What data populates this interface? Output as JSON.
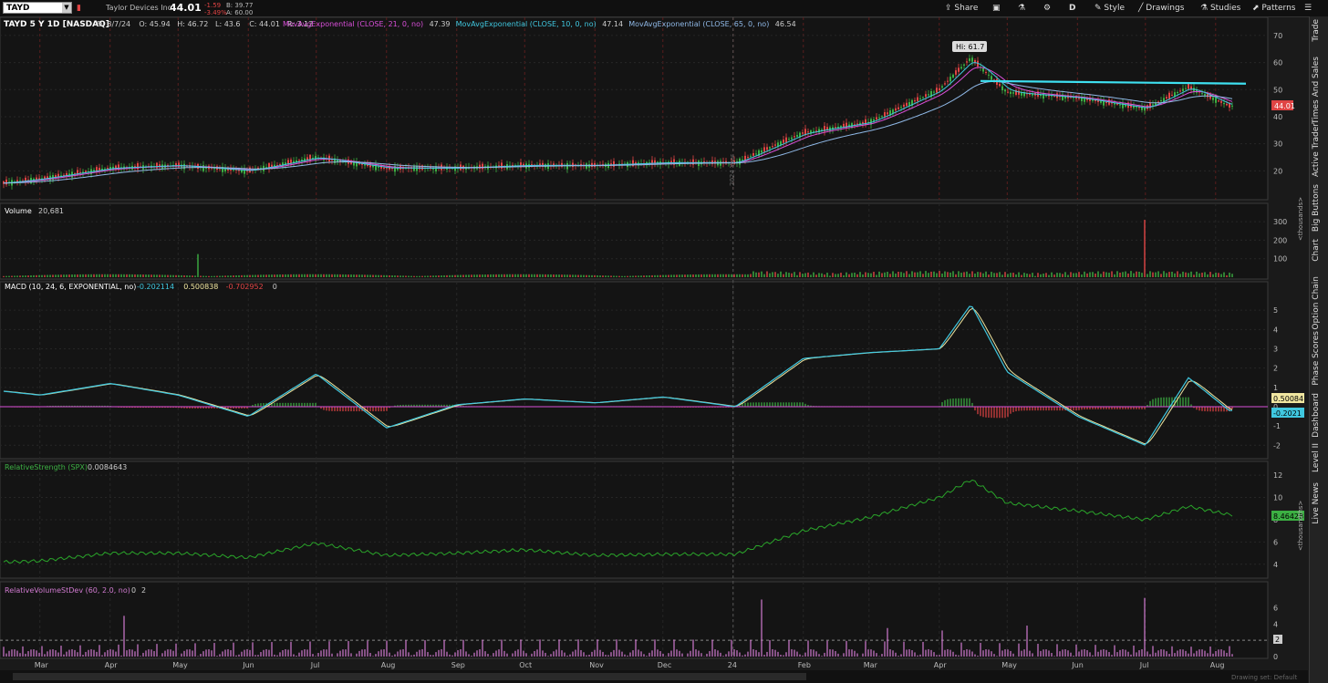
{
  "topbar": {
    "symbol": "TAYD",
    "company": "Taylor Devices Inc",
    "last": "44.01",
    "change": "-1.59",
    "change_pct": "-3.49%",
    "bid": "B: 39.77",
    "ask": "A: 60.00",
    "tools": [
      "Share",
      "D",
      "Style",
      "Drawings",
      "Studies",
      "Patterns"
    ]
  },
  "sidebar_tabs": [
    "Trade",
    "Times And Sales",
    "Active Trader",
    "Big Buttons",
    "Chart",
    "Option Chain",
    "Phase Scores",
    "Dashboard",
    "Level II",
    "Live News"
  ],
  "price_panel": {
    "title": "TAYD 5 Y 1D [NASDAQ]",
    "ohlc": [
      "D: 8/7/24",
      "O: 45.94",
      "H: 46.72",
      "L: 43.6",
      "C: 44.01",
      "R: 3.12"
    ],
    "studies": [
      {
        "label": "MovAvgExponential (CLOSE, 21, 0, no)",
        "value": "47.39",
        "color": "#d94fd9"
      },
      {
        "label": "MovAvgExponential (CLOSE, 10, 0, no)",
        "value": "47.14",
        "color": "#40c8e0"
      },
      {
        "label": "MovAvgExponential (CLOSE, 65, 0, no)",
        "value": "46.54",
        "color": "#8fb8e6"
      }
    ],
    "hi_label": "Hi: 61.7",
    "last_label": "44.01",
    "y_ticks": [
      "70",
      "60",
      "50",
      "40",
      "30",
      "20"
    ]
  },
  "volume_panel": {
    "title": "Volume",
    "value": "20,681",
    "y_ticks": [
      "300",
      "200",
      "100"
    ],
    "unit": "<thousands>"
  },
  "macd_panel": {
    "title": "MACD (10, 24, 6, EXPONENTIAL, no)",
    "values": [
      "-0.202114",
      "0.500838",
      "-0.702952",
      "0"
    ],
    "value_colors": [
      "#40c8e0",
      "#f0e6a0",
      "#e04444",
      "#cccccc"
    ],
    "y_ticks": [
      "5",
      "4",
      "3",
      "2",
      "1",
      "0",
      "-1",
      "-2"
    ],
    "label_signal": "0.50084",
    "label_macd": "-0.2021"
  },
  "rs_panel": {
    "title": "RelativeStrength (SPX)",
    "value": "0.0084643",
    "y_ticks": [
      "12",
      "10",
      "8",
      "6",
      "4"
    ],
    "unit": "<thousandths>",
    "label": "8.46428"
  },
  "rvol_panel": {
    "title": "RelativeVolumeStDev (60, 2.0, no)",
    "values": [
      "0",
      "2"
    ],
    "y_ticks": [
      "6",
      "4",
      "2",
      "0"
    ],
    "label": "2"
  },
  "x_axis": [
    "Mar",
    "Apr",
    "May",
    "Jun",
    "Jul",
    "Aug",
    "Sep",
    "Oct",
    "Nov",
    "Dec",
    "24",
    "Feb",
    "Mar",
    "Apr",
    "May",
    "Jun",
    "Jul",
    "Aug"
  ],
  "year_marker": "2024 Year",
  "footer": "Drawing set: Default",
  "colors": {
    "up": "#3cb043",
    "down": "#e04444",
    "trendline": "#3ee0f0",
    "ema21": "#d94fd9",
    "ema10": "#40c8e0",
    "ema65": "#8fb8e6",
    "rs": "#2aa52a",
    "rvol": "#d07ad0"
  },
  "chart_data": {
    "type": "line",
    "x": [
      "2023-02-13",
      "2023-03-01",
      "2023-04-01",
      "2023-05-01",
      "2023-06-01",
      "2023-07-01",
      "2023-08-01",
      "2023-09-01",
      "2023-10-01",
      "2023-11-01",
      "2023-12-01",
      "2024-01-02",
      "2024-02-01",
      "2024-03-01",
      "2024-04-01",
      "2024-04-15",
      "2024-05-01",
      "2024-06-01",
      "2024-07-01",
      "2024-07-20",
      "2024-08-07"
    ],
    "series": [
      {
        "name": "Close",
        "values": [
          15.5,
          17,
          21,
          22,
          20,
          25,
          21,
          21,
          22,
          22,
          23,
          23,
          34,
          38,
          50,
          61.7,
          49,
          47,
          43,
          51,
          44.01
        ]
      }
    ],
    "macd": [
      0.8,
      0.6,
      1.2,
      0.6,
      -0.5,
      1.7,
      -1.1,
      0.1,
      0.4,
      0.2,
      0.5,
      0,
      2.5,
      2.8,
      3.0,
      5.3,
      1.8,
      -0.5,
      -2.0,
      1.5,
      -0.2
    ],
    "relative_strength": [
      4.2,
      4.3,
      5.0,
      5.0,
      4.6,
      5.9,
      4.8,
      5.0,
      5.3,
      4.8,
      4.9,
      4.9,
      7.0,
      8.2,
      10.0,
      11.6,
      9.5,
      8.8,
      8.0,
      9.2,
      8.46
    ],
    "ylim": [
      10,
      72
    ]
  }
}
